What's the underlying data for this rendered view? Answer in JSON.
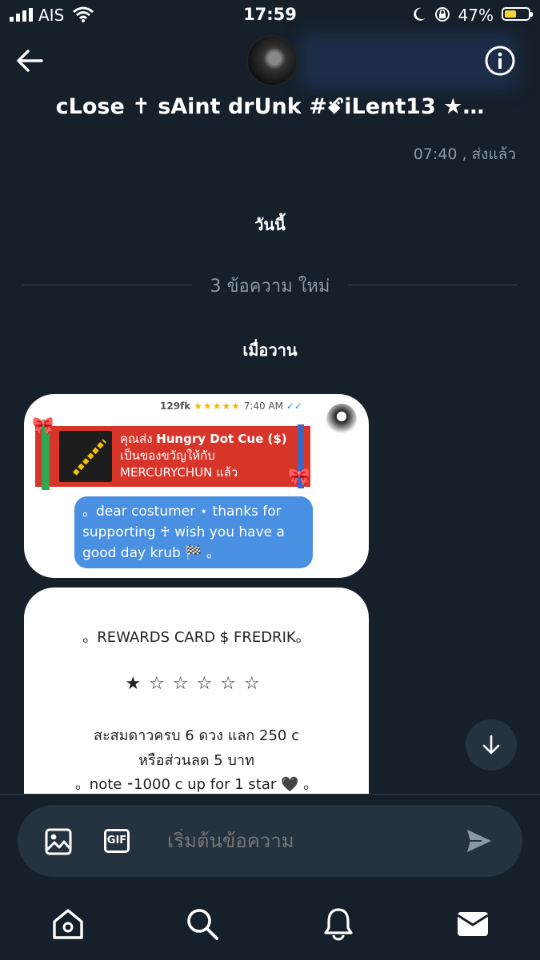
{
  "status_bar": {
    "carrier": "AIS",
    "time": "17:59",
    "battery_percent": "47%"
  },
  "header": {
    "title": "cLose ✝ sAint drUnk #ꗄiLent13 ★…",
    "back_icon": "back-arrow-icon",
    "info_icon": "info-icon"
  },
  "conversation": {
    "last_sent": "07:40 , ส่งแล้ว",
    "today_label": "วันนี้",
    "new_messages": "3 ข้อความ ใหม่",
    "yesterday_label": "เมื่อวาน"
  },
  "card1": {
    "meta_user": "129fk",
    "meta_stars": "★★★★★",
    "meta_time": "7:40 AM",
    "gift_line1_prefix": "คุณส่ง ",
    "gift_item": "Hungry Dot Cue ($)",
    "gift_line2": "เป็นของขวัญให้กับ",
    "gift_line3": "MERCURYCHUN แล้ว",
    "bubble_text": "。dear costumer ⋆ thanks for supporting ♰ wish you have a good day krub 🏁 。"
  },
  "card2": {
    "title": "。REWARDS CARD $ FREDRIK。",
    "stars": "★☆☆☆☆☆",
    "line1": "สะสมดาวครบ 6 ดวง แลก 250 c",
    "line2": "หรือส่วนลด 5 บาท",
    "line3": "。note ⁃1000 c up for 1 star 🖤 。"
  },
  "composer": {
    "placeholder": "เริ่มต้นข้อความ",
    "gif_label": "GIF"
  },
  "colors": {
    "background": "#15202b",
    "composer": "#253341",
    "accent_blue": "#4a90e2",
    "gift_red": "#d8352a"
  }
}
